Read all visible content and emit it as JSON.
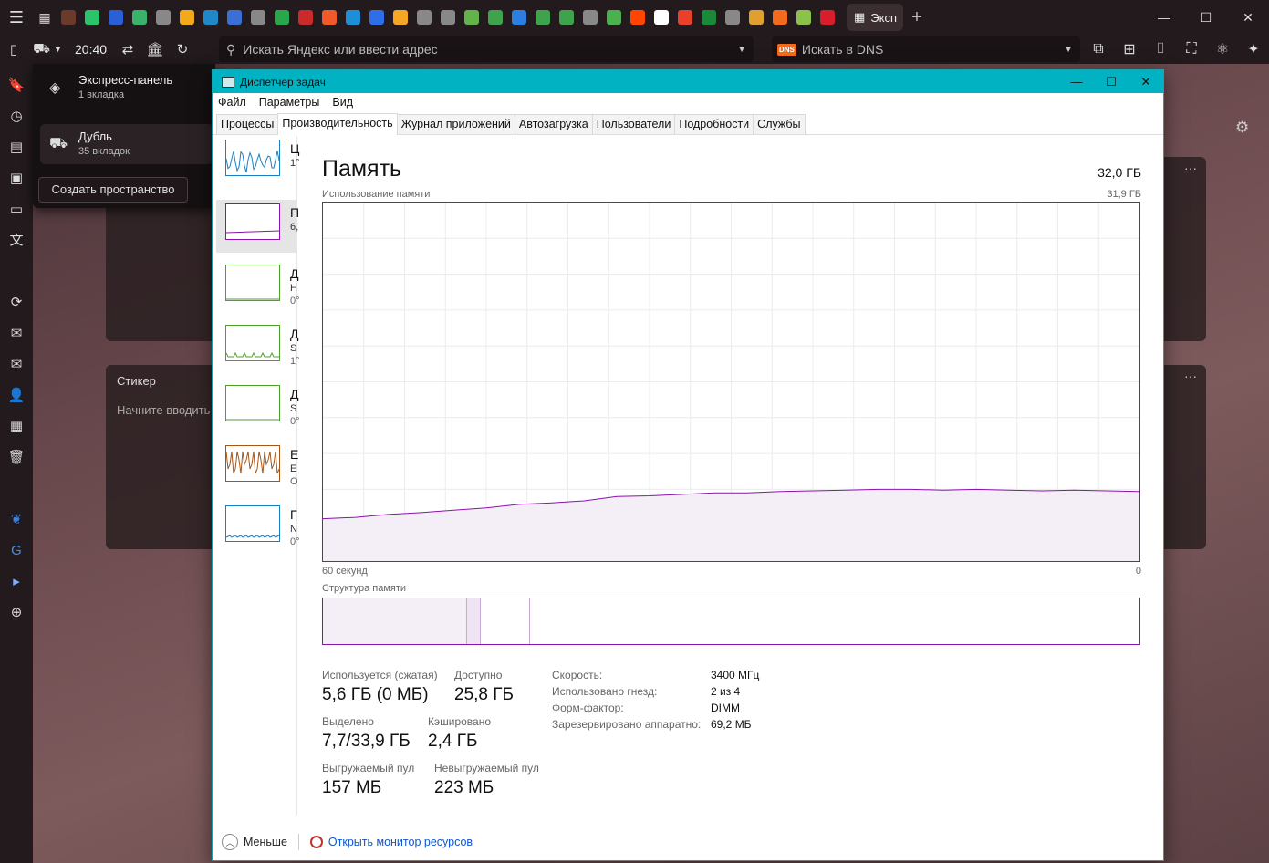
{
  "browser": {
    "time": "20:40",
    "address_placeholder": "Искать Яндекс или ввести адрес",
    "search_placeholder": "Искать в DNS",
    "search_engine_badge": "DNS",
    "active_tab_label": "Эксп",
    "tab_icon_colors": [
      "#6b3b2a",
      "#29c46b",
      "#2a5fd6",
      "#3ab36a",
      "#888",
      "#f2a91a",
      "#1e88c8",
      "#3a6fd6",
      "#888",
      "#28a84a",
      "#cc2a2a",
      "#f05a28",
      "#1e8fd6",
      "#2e6ee8",
      "#f5a623",
      "#888",
      "#888",
      "#62b34a",
      "#3fa34d",
      "#2a7fe0",
      "#3fa34d",
      "#3fa34d",
      "#888",
      "#4caf50",
      "#ff4500",
      "#fff",
      "#e8402a",
      "#1a8a3a",
      "#888",
      "#e0a030",
      "#f26a1b",
      "#8bc34a",
      "#d81e2a"
    ]
  },
  "workspaces": {
    "items": [
      {
        "name": "Экспресс-панель",
        "count": "1 вкладка"
      },
      {
        "name": "Дубль",
        "count": "35 вкладок"
      }
    ],
    "create_label": "Создать пространство"
  },
  "background_widgets": {
    "sticker_title": "Стикер",
    "sticker_placeholder": "Начните вводить"
  },
  "task_manager": {
    "title": "Диспетчер задач",
    "menu": [
      "Файл",
      "Параметры",
      "Вид"
    ],
    "tabs": [
      "Процессы",
      "Производительность",
      "Журнал приложений",
      "Автозагрузка",
      "Пользователи",
      "Подробности",
      "Службы"
    ],
    "active_tab": "Производительность",
    "resources": [
      {
        "l1": "Ц",
        "l2": "1°",
        "l3": "",
        "color": "#1b7fc4"
      },
      {
        "l1": "П",
        "l2": "6,",
        "l3": "",
        "color": "#8b12ae"
      },
      {
        "l1": "Д",
        "l2": "Н",
        "l3": "0°",
        "color": "#4da22e"
      },
      {
        "l1": "Д",
        "l2": "S",
        "l3": "1°",
        "color": "#4da22e"
      },
      {
        "l1": "Д",
        "l2": "S",
        "l3": "0°",
        "color": "#4da22e"
      },
      {
        "l1": "E",
        "l2": "E",
        "l3": "O",
        "color": "#a7561a"
      },
      {
        "l1": "Г",
        "l2": "N",
        "l3": "0°",
        "color": "#1b7fc4"
      }
    ],
    "memory": {
      "heading": "Память",
      "total": "32,0 ГБ",
      "usage_label": "Использование памяти",
      "usage_max": "31,9 ГБ",
      "time_left": "60 секунд",
      "time_right": "0",
      "structure_label": "Структура памяти",
      "usage_series": [
        0.118,
        0.122,
        0.13,
        0.135,
        0.142,
        0.148,
        0.158,
        0.162,
        0.168,
        0.18,
        0.182,
        0.186,
        0.19,
        0.19,
        0.194,
        0.196,
        0.198,
        0.2,
        0.2,
        0.198,
        0.2,
        0.198,
        0.196,
        0.198,
        0.196,
        0.194
      ],
      "stats": [
        {
          "label": "Используется (сжатая)",
          "value": "5,6 ГБ (0 МБ)"
        },
        {
          "label": "Доступно",
          "value": "25,8 ГБ"
        },
        {
          "label": "Выделено",
          "value": "7,7/33,9 ГБ"
        },
        {
          "label": "Кэшировано",
          "value": "2,4 ГБ"
        },
        {
          "label": "Выгружаемый пул",
          "value": "157 МБ"
        },
        {
          "label": "Невыгружаемый пул",
          "value": "223 МБ"
        }
      ],
      "specs": [
        {
          "label": "Скорость:",
          "value": "3400 МГц"
        },
        {
          "label": "Использовано гнезд:",
          "value": "2 из 4"
        },
        {
          "label": "Форм-фактор:",
          "value": "DIMM"
        },
        {
          "label": "Зарезервировано аппаратно:",
          "value": "69,2 МБ"
        }
      ]
    },
    "footer": {
      "less_label": "Меньше",
      "resmon_link": "Открыть монитор ресурсов"
    }
  }
}
